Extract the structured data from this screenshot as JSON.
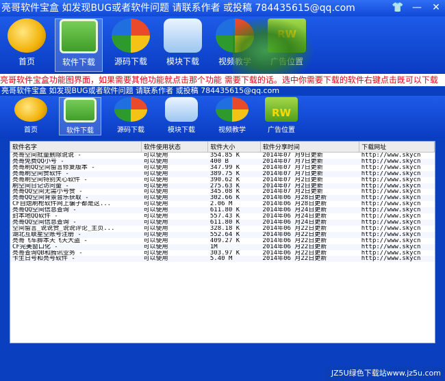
{
  "window": {
    "title": "亮哥软件宝盒  如发现BUG或者软件问题  请联系作者  或投稿  784435615@qq.com",
    "controls": [
      "👕",
      "—",
      "✕"
    ]
  },
  "toolbar": {
    "items": [
      {
        "label": "首页",
        "icon": "home-plus-icon"
      },
      {
        "label": "软件下载",
        "icon": "download-icon",
        "selected": true
      },
      {
        "label": "源码下载",
        "icon": "windows-logo-icon"
      },
      {
        "label": "模块下载",
        "icon": "monitor-icon"
      },
      {
        "label": "视频教学",
        "icon": "windows-logo-icon"
      },
      {
        "label": "广告位置",
        "icon": "ad-icon",
        "badge": "RW"
      }
    ]
  },
  "notice": "亮哥软件宝盒功能图界面，如果需要其他功能就点击那个功能 需要下载的话。选中你需要下载的软件右键点击既可以下载",
  "inner_window": {
    "title": "亮哥软件宝盒  如发现BUG或者软件问题  请联系作者  或投稿  784435615@qq.com"
  },
  "table": {
    "columns": [
      "软件名字",
      "软件使用状态",
      "软件大小",
      "软件分享时间",
      "下载网址"
    ],
    "rows": [
      [
        "亮哥空间批量删除说说 -",
        "可以使用",
        "354.85 K",
        "2014年07 月9日更新",
        "http://www.skycn"
      ],
      [
        "亮哥免费QQ小号 -",
        "可以使用",
        "400 B",
        "2014年07 月7日更新",
        "http://www.skycn"
      ],
      [
        "亮哥刷QQ空间留言修复版本 -",
        "可以使用",
        "347.99 K",
        "2014年07 月7日更新",
        "http://www.skycn"
      ],
      [
        "亮哥刷空间赞软件 -",
        "可以使用",
        "389.75 K",
        "2014年07 月7日更新",
        "http://www.skycn"
      ],
      [
        "亮哥刷空间特别关心软件 -",
        "可以使用",
        "390.62 K",
        "2014年07 月2日更新",
        "http://www.skycn"
      ],
      [
        "刷空间日记访问量 -",
        "可以使用",
        "275.63 K",
        "2014年07 月2日更新",
        "http://www.skycn"
      ],
      [
        "亮哥QQ空间无需小号赞 -",
        "可以使用",
        "345.08 K",
        "2014年07 月2日更新",
        "http://www.skycn"
      ],
      [
        "亮哥QQ空间背景音乐获取 -",
        "可以使用",
        "302.66 K",
        "2014年06 月28日更新",
        "http://www.skycn"
      ],
      [
        "CF自熄刷枪软件网上骗子都是这...",
        "可以使用",
        "2.06 M",
        "2014年06 月28日更新",
        "http://www.skycn"
      ],
      [
        "亮哥QQ空间信息查询 -",
        "可以使用",
        "611.80 K",
        "2014年06 月24日更新",
        "http://www.skycn"
      ],
      [
        "封本地QQ软件 -",
        "可以使用",
        "557.43 K",
        "2014年06 月24日更新",
        "http://www.skycn"
      ],
      [
        "亮哥QQ空间信息查询 -",
        "可以使用",
        "611.80 K",
        "2014年06 月24日更新",
        "http://www.skycn"
      ],
      [
        "空间留言_说说赞_说说评论_主页...",
        "可以使用",
        "328.18 K",
        "2014年06 月22日更新",
        "http://www.skycn"
      ],
      [
        "湖北互联星空账号注册 -",
        "可以使用",
        "552.64 K",
        "2014年06 月22日更新",
        "http://www.skycn"
      ],
      [
        "亮哥飞车脚本天飞天大盗 -",
        "可以使用",
        "409.27 K",
        "2014年06 月22日更新",
        "http://www.skycn"
      ],
      [
        "CF完美窗口化 -",
        "可以使用",
        "1M",
        "2014年06 月22日更新",
        "http://www.skycn"
      ],
      [
        "亮哥查询QB和腾讯业务 -",
        "可以使用",
        "303.97 K",
        "2014年06 月22日更新",
        "http://www.skycn"
      ],
      [
        "卡生日号和亮号软件 -",
        "可以使用",
        "5.40 M",
        "2014年06 月22日更新",
        "http://www.skycn"
      ]
    ]
  },
  "watermark": "JZ5U绿色下载站www.jz5u.com"
}
